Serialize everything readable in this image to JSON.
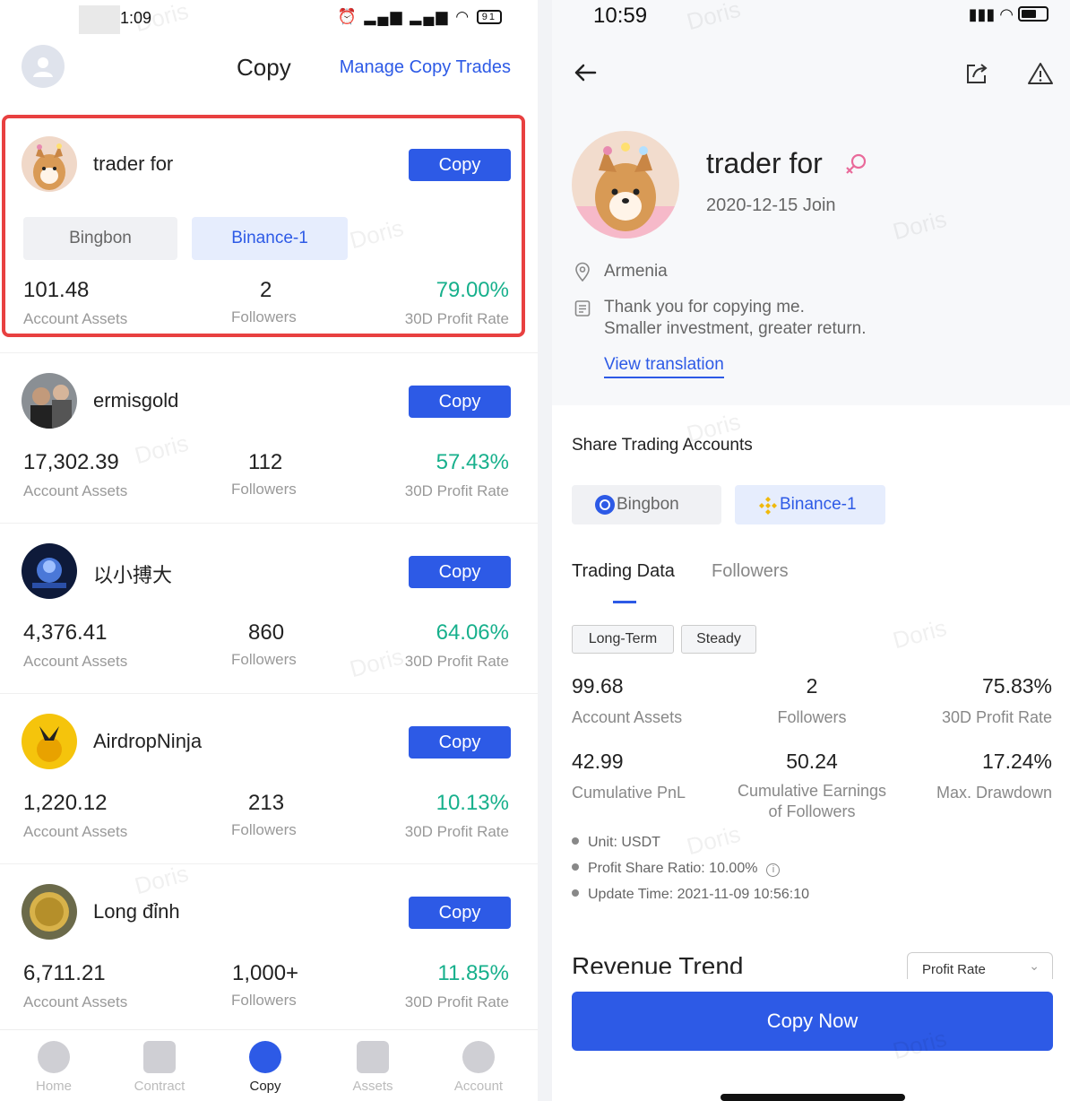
{
  "left": {
    "status_bar": {
      "time": "1:09",
      "battery": "91"
    },
    "header": {
      "title": "Copy",
      "manage_label": "Manage Copy Trades"
    },
    "traders": [
      {
        "name": "trader for",
        "copy_label": "Copy",
        "accounts": [
          "Bingbon",
          "Binance-1"
        ],
        "assets": "101.48",
        "assets_label": "Account Assets",
        "followers": "2",
        "followers_label": "Followers",
        "profit": "79.00%",
        "profit_label": "30D Profit Rate"
      },
      {
        "name": "ermisgold",
        "copy_label": "Copy",
        "assets": "17,302.39",
        "assets_label": "Account Assets",
        "followers": "112",
        "followers_label": "Followers",
        "profit": "57.43%",
        "profit_label": "30D Profit Rate"
      },
      {
        "name": "以小搏大",
        "copy_label": "Copy",
        "assets": "4,376.41",
        "assets_label": "Account Assets",
        "followers": "860",
        "followers_label": "Followers",
        "profit": "64.06%",
        "profit_label": "30D Profit Rate"
      },
      {
        "name": "AirdropNinja",
        "copy_label": "Copy",
        "assets": "1,220.12",
        "assets_label": "Account Assets",
        "followers": "213",
        "followers_label": "Followers",
        "profit": "10.13%",
        "profit_label": "30D Profit Rate"
      },
      {
        "name": "Long đỉnh",
        "copy_label": "Copy",
        "assets": "6,711.21",
        "assets_label": "Account Assets",
        "followers": "1,000+",
        "followers_label": "Followers",
        "profit": "11.85%",
        "profit_label": "30D Profit Rate"
      }
    ],
    "nav": [
      "Home",
      "Contract",
      "Copy",
      "Assets",
      "Account"
    ]
  },
  "right": {
    "status_bar": {
      "time": "10:59"
    },
    "profile": {
      "name": "trader for",
      "join": "2020-12-15 Join",
      "location": "Armenia",
      "bio_line1": "Thank you for copying me.",
      "bio_line2": "Smaller investment, greater return.",
      "translate_label": "View translation"
    },
    "share_title": "Share Trading Accounts",
    "accounts": [
      "Bingbon",
      "Binance-1"
    ],
    "tabs": [
      "Trading Data",
      "Followers"
    ],
    "pills": [
      "Long-Term",
      "Steady"
    ],
    "stats": {
      "assets": "99.68",
      "assets_label": "Account Assets",
      "followers": "2",
      "followers_label": "Followers",
      "profit": "75.83%",
      "profit_label": "30D Profit Rate",
      "pnl": "42.99",
      "pnl_label": "Cumulative PnL",
      "earnings": "50.24",
      "earnings_label_1": "Cumulative Earnings",
      "earnings_label_2": "of Followers",
      "drawdown": "17.24%",
      "drawdown_label": "Max. Drawdown"
    },
    "notes": {
      "unit": "Unit: USDT",
      "ratio": "Profit Share Ratio: 10.00%",
      "update": "Update Time: 2021-11-09 10:56:10"
    },
    "revenue_title": "Revenue Trend",
    "revenue_select": "Profit Rate",
    "copy_now_label": "Copy Now"
  },
  "watermark": "Doris",
  "colors": {
    "primary": "#2d5ae6",
    "profit_green": "#17b08c",
    "highlight_red": "#e84040"
  }
}
